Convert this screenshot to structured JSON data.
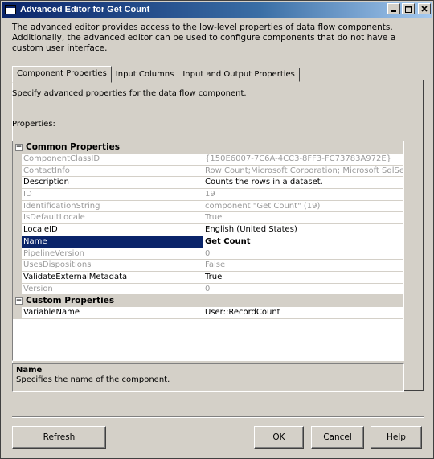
{
  "window": {
    "title": "Advanced Editor for Get Count",
    "intro": "The advanced editor provides access to the low-level properties of data flow components. Additionally, the advanced editor can be used to configure components that do not have a custom user interface."
  },
  "tabs": [
    {
      "label": "Component Properties",
      "active": true
    },
    {
      "label": "Input Columns",
      "active": false
    },
    {
      "label": "Input and Output Properties",
      "active": false
    }
  ],
  "panel": {
    "description": "Specify advanced properties for the data flow component.",
    "properties_label": "Properties:"
  },
  "grid": {
    "categories": [
      {
        "name": "Common Properties",
        "expander": "−",
        "rows": [
          {
            "name": "ComponentClassID",
            "value": "{150E6007-7C6A-4CC3-8FF3-FC73783A972E}",
            "readonly": true
          },
          {
            "name": "ContactInfo",
            "value": "Row Count;Microsoft Corporation; Microsoft SqlServer v10;",
            "readonly": true
          },
          {
            "name": "Description",
            "value": "Counts the rows in a dataset.",
            "readonly": false
          },
          {
            "name": "ID",
            "value": "19",
            "readonly": true
          },
          {
            "name": "IdentificationString",
            "value": "component \"Get Count\" (19)",
            "readonly": true
          },
          {
            "name": "IsDefaultLocale",
            "value": "True",
            "readonly": true
          },
          {
            "name": "LocaleID",
            "value": "English (United States)",
            "readonly": false
          },
          {
            "name": "Name",
            "value": "Get Count",
            "readonly": false,
            "selected": true
          },
          {
            "name": "PipelineVersion",
            "value": "0",
            "readonly": true
          },
          {
            "name": "UsesDispositions",
            "value": "False",
            "readonly": true
          },
          {
            "name": "ValidateExternalMetadata",
            "value": "True",
            "readonly": false
          },
          {
            "name": "Version",
            "value": "0",
            "readonly": true
          }
        ]
      },
      {
        "name": "Custom Properties",
        "expander": "−",
        "rows": [
          {
            "name": "VariableName",
            "value": "User::RecordCount",
            "readonly": false
          }
        ]
      }
    ]
  },
  "help": {
    "title": "Name",
    "text": "Specifies the name of the component."
  },
  "buttons": {
    "refresh": "Refresh",
    "ok": "OK",
    "cancel": "Cancel",
    "help": "Help"
  },
  "colors": {
    "titlebar": "#0a246a",
    "selection": "#0a246a",
    "dialog_bg": "#d4d0c8",
    "readonly_text": "#9a9a9a"
  }
}
